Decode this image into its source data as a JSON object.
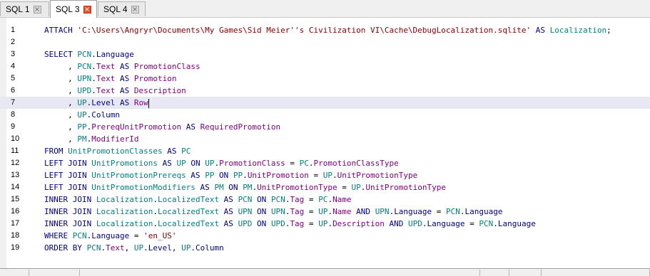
{
  "tabs": [
    {
      "label": "SQL 1",
      "active": false
    },
    {
      "label": "SQL 3",
      "active": true
    },
    {
      "label": "SQL 4",
      "active": false
    }
  ],
  "editor": {
    "current_line": 7,
    "lines": [
      {
        "n": "1",
        "tokens": [
          [
            "kw",
            "ATTACH "
          ],
          [
            "st",
            "'C:\\Users\\Angryr\\Documents\\My Games\\Sid Meier''s Civilization VI\\Cache\\DebugLocalization.sqlite'"
          ],
          [
            "kw",
            " AS "
          ],
          [
            "tb",
            "Localization"
          ],
          [
            "op",
            ";"
          ]
        ]
      },
      {
        "n": "2",
        "tokens": []
      },
      {
        "n": "3",
        "tokens": [
          [
            "kw",
            "SELECT "
          ],
          [
            "tb",
            "PCN"
          ],
          [
            "op",
            "."
          ],
          [
            "kw",
            "Language"
          ]
        ]
      },
      {
        "n": "4",
        "tokens": [
          [
            "op",
            "     , "
          ],
          [
            "tb",
            "PCN"
          ],
          [
            "op",
            "."
          ],
          [
            "cl",
            "Text"
          ],
          [
            "kw",
            " AS "
          ],
          [
            "cl",
            "PromotionClass"
          ]
        ]
      },
      {
        "n": "5",
        "tokens": [
          [
            "op",
            "     , "
          ],
          [
            "tb",
            "UPN"
          ],
          [
            "op",
            "."
          ],
          [
            "cl",
            "Text"
          ],
          [
            "kw",
            " AS "
          ],
          [
            "cl",
            "Promotion"
          ]
        ]
      },
      {
        "n": "6",
        "tokens": [
          [
            "op",
            "     , "
          ],
          [
            "tb",
            "UPD"
          ],
          [
            "op",
            "."
          ],
          [
            "cl",
            "Text"
          ],
          [
            "kw",
            " AS "
          ],
          [
            "cl",
            "Description"
          ]
        ]
      },
      {
        "n": "7",
        "tokens": [
          [
            "op",
            "     , "
          ],
          [
            "tb",
            "UP"
          ],
          [
            "op",
            "."
          ],
          [
            "kw",
            "Level"
          ],
          [
            "kw",
            " AS "
          ],
          [
            "cl",
            "Row"
          ]
        ]
      },
      {
        "n": "8",
        "tokens": [
          [
            "op",
            "     , "
          ],
          [
            "tb",
            "UP"
          ],
          [
            "op",
            "."
          ],
          [
            "kw",
            "Column"
          ]
        ]
      },
      {
        "n": "9",
        "tokens": [
          [
            "op",
            "     , "
          ],
          [
            "tb",
            "PP"
          ],
          [
            "op",
            "."
          ],
          [
            "cl",
            "PrereqUnitPromotion"
          ],
          [
            "kw",
            " AS "
          ],
          [
            "cl",
            "RequiredPromotion"
          ]
        ]
      },
      {
        "n": "10",
        "tokens": [
          [
            "op",
            "     , "
          ],
          [
            "tb",
            "PM"
          ],
          [
            "op",
            "."
          ],
          [
            "cl",
            "ModifierId"
          ]
        ]
      },
      {
        "n": "11",
        "tokens": [
          [
            "kw",
            "FROM "
          ],
          [
            "tb",
            "UnitPromotionClasses"
          ],
          [
            "kw",
            " AS "
          ],
          [
            "tb",
            "PC"
          ]
        ]
      },
      {
        "n": "12",
        "tokens": [
          [
            "kw",
            "LEFT JOIN "
          ],
          [
            "tb",
            "UnitPromotions"
          ],
          [
            "kw",
            " AS "
          ],
          [
            "tb",
            "UP"
          ],
          [
            "kw",
            " ON "
          ],
          [
            "tb",
            "UP"
          ],
          [
            "op",
            "."
          ],
          [
            "cl",
            "PromotionClass"
          ],
          [
            "op",
            " = "
          ],
          [
            "tb",
            "PC"
          ],
          [
            "op",
            "."
          ],
          [
            "cl",
            "PromotionClassType"
          ]
        ]
      },
      {
        "n": "13",
        "tokens": [
          [
            "kw",
            "LEFT JOIN "
          ],
          [
            "tb",
            "UnitPromotionPrereqs"
          ],
          [
            "kw",
            " AS "
          ],
          [
            "tb",
            "PP"
          ],
          [
            "kw",
            " ON "
          ],
          [
            "tb",
            "PP"
          ],
          [
            "op",
            "."
          ],
          [
            "cl",
            "UnitPromotion"
          ],
          [
            "op",
            " = "
          ],
          [
            "tb",
            "UP"
          ],
          [
            "op",
            "."
          ],
          [
            "cl",
            "UnitPromotionType"
          ]
        ]
      },
      {
        "n": "14",
        "tokens": [
          [
            "kw",
            "LEFT JOIN "
          ],
          [
            "tb",
            "UnitPromotionModifiers"
          ],
          [
            "kw",
            " AS "
          ],
          [
            "tb",
            "PM"
          ],
          [
            "kw",
            " ON "
          ],
          [
            "tb",
            "PM"
          ],
          [
            "op",
            "."
          ],
          [
            "cl",
            "UnitPromotionType"
          ],
          [
            "op",
            " = "
          ],
          [
            "tb",
            "UP"
          ],
          [
            "op",
            "."
          ],
          [
            "cl",
            "UnitPromotionType"
          ]
        ]
      },
      {
        "n": "15",
        "tokens": [
          [
            "kw",
            "INNER JOIN "
          ],
          [
            "tb",
            "Localization"
          ],
          [
            "op",
            "."
          ],
          [
            "tb",
            "LocalizedText"
          ],
          [
            "kw",
            " AS "
          ],
          [
            "tb",
            "PCN"
          ],
          [
            "kw",
            " ON "
          ],
          [
            "tb",
            "PCN"
          ],
          [
            "op",
            "."
          ],
          [
            "cl",
            "Tag"
          ],
          [
            "op",
            " = "
          ],
          [
            "tb",
            "PC"
          ],
          [
            "op",
            "."
          ],
          [
            "cl",
            "Name"
          ]
        ]
      },
      {
        "n": "16",
        "tokens": [
          [
            "kw",
            "INNER JOIN "
          ],
          [
            "tb",
            "Localization"
          ],
          [
            "op",
            "."
          ],
          [
            "tb",
            "LocalizedText"
          ],
          [
            "kw",
            " AS "
          ],
          [
            "tb",
            "UPN"
          ],
          [
            "kw",
            " ON "
          ],
          [
            "tb",
            "UPN"
          ],
          [
            "op",
            "."
          ],
          [
            "cl",
            "Tag"
          ],
          [
            "op",
            " = "
          ],
          [
            "tb",
            "UP"
          ],
          [
            "op",
            "."
          ],
          [
            "cl",
            "Name"
          ],
          [
            "kw",
            " AND "
          ],
          [
            "tb",
            "UPN"
          ],
          [
            "op",
            "."
          ],
          [
            "kw",
            "Language"
          ],
          [
            "op",
            " = "
          ],
          [
            "tb",
            "PCN"
          ],
          [
            "op",
            "."
          ],
          [
            "kw",
            "Language"
          ]
        ]
      },
      {
        "n": "17",
        "tokens": [
          [
            "kw",
            "INNER JOIN "
          ],
          [
            "tb",
            "Localization"
          ],
          [
            "op",
            "."
          ],
          [
            "tb",
            "LocalizedText"
          ],
          [
            "kw",
            " AS "
          ],
          [
            "tb",
            "UPD"
          ],
          [
            "kw",
            " ON "
          ],
          [
            "tb",
            "UPD"
          ],
          [
            "op",
            "."
          ],
          [
            "cl",
            "Tag"
          ],
          [
            "op",
            " = "
          ],
          [
            "tb",
            "UP"
          ],
          [
            "op",
            "."
          ],
          [
            "cl",
            "Description"
          ],
          [
            "kw",
            " AND "
          ],
          [
            "tb",
            "UPD"
          ],
          [
            "op",
            "."
          ],
          [
            "kw",
            "Language"
          ],
          [
            "op",
            " = "
          ],
          [
            "tb",
            "PCN"
          ],
          [
            "op",
            "."
          ],
          [
            "kw",
            "Language"
          ]
        ]
      },
      {
        "n": "18",
        "tokens": [
          [
            "kw",
            "WHERE "
          ],
          [
            "tb",
            "PCN"
          ],
          [
            "op",
            "."
          ],
          [
            "kw",
            "Language"
          ],
          [
            "op",
            " = "
          ],
          [
            "st",
            "'en_US'"
          ]
        ]
      },
      {
        "n": "19",
        "tokens": [
          [
            "kw",
            "ORDER BY "
          ],
          [
            "tb",
            "PCN"
          ],
          [
            "op",
            "."
          ],
          [
            "cl",
            "Text"
          ],
          [
            "op",
            ", "
          ],
          [
            "tb",
            "UP"
          ],
          [
            "op",
            "."
          ],
          [
            "kw",
            "Level"
          ],
          [
            "op",
            ", "
          ],
          [
            "tb",
            "UP"
          ],
          [
            "op",
            "."
          ],
          [
            "kw",
            "Column"
          ]
        ]
      }
    ]
  },
  "colors": {
    "keyword": "#000080",
    "table": "#008080",
    "column": "#800080",
    "string": "#800000",
    "active_tab_close": "#e0502b",
    "current_line_bg": "#e8e8f4"
  },
  "icons": {
    "tab_close": "close-icon"
  }
}
